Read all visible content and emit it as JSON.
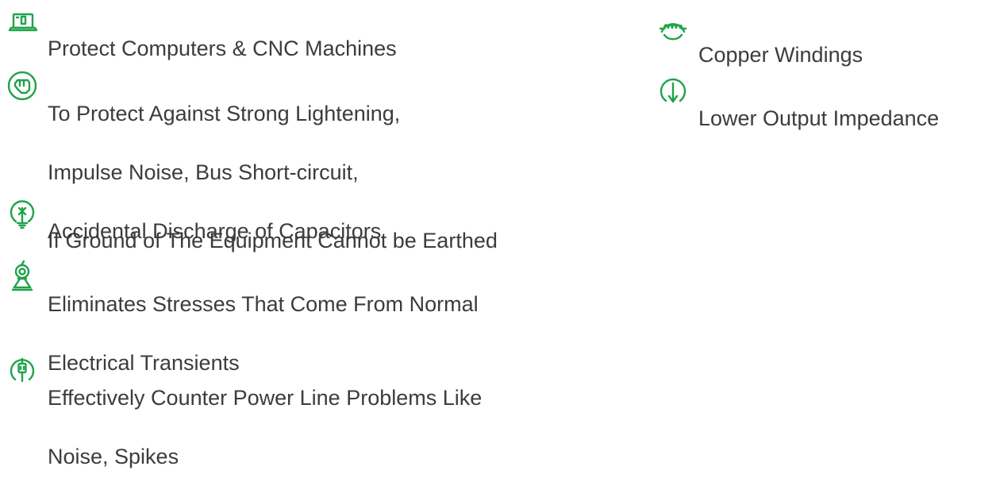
{
  "accent_color": "#1fa34a",
  "features_left": [
    {
      "icon": "computer-icon",
      "lines": [
        "Protect Computers & CNC Machines"
      ]
    },
    {
      "icon": "hand-shield-icon",
      "lines": [
        "To Protect Against Strong Lightening,",
        "Impulse Noise, Bus Short-circuit,",
        "Accidental Discharge of Capacitors"
      ]
    },
    {
      "icon": "ground-icon",
      "lines": [
        "If Ground of The Equipment Cannot be Earthed"
      ]
    },
    {
      "icon": "stress-relief-icon",
      "lines": [
        "Eliminates Stresses That Come From Normal",
        "Electrical Transients"
      ]
    },
    {
      "icon": "power-plug-icon",
      "lines": [
        "Effectively Counter Power Line Problems Like",
        "Noise, Spikes"
      ]
    }
  ],
  "features_right": [
    {
      "icon": "coil-icon",
      "lines": [
        "Copper Windings"
      ]
    },
    {
      "icon": "arrow-down-circle-icon",
      "lines": [
        "Lower Output Impedance"
      ]
    }
  ]
}
